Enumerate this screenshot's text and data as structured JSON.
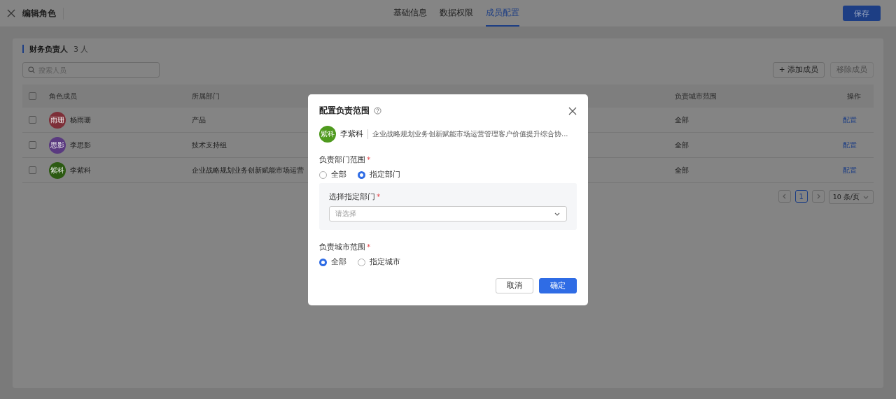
{
  "header": {
    "title": "编辑角色",
    "tabs": [
      {
        "label": "基础信息",
        "selected": false
      },
      {
        "label": "数据权限",
        "selected": false
      },
      {
        "label": "成员配置",
        "selected": true
      }
    ],
    "save": "保存"
  },
  "section": {
    "title": "财务负责人",
    "count": "3 人",
    "search": {
      "placeholder": "搜索人员"
    },
    "add": "添加成员",
    "add_icon": "+",
    "remove": {
      "label": "移除成员",
      "disabled": true
    }
  },
  "table": {
    "all_checked": false,
    "columns": [
      "角色成员",
      "所属部门",
      "负责城市范围",
      "操作"
    ],
    "rows": [
      {
        "checked": false,
        "avatar": "雨珊",
        "color": "#7d2f38",
        "name": "杨雨珊",
        "dept": "产品",
        "city": "全部",
        "action": "配置"
      },
      {
        "checked": false,
        "avatar": "思影",
        "color": "#5a3a80",
        "name": "李思影",
        "dept": "技术支持组",
        "city": "全部",
        "action": "配置"
      },
      {
        "checked": false,
        "avatar": "紫科",
        "color": "#2c5a12",
        "name": "李紫科",
        "dept": "企业战略规划业务创新赋能市场运营",
        "city": "全部",
        "action": "配置"
      }
    ]
  },
  "pagination": {
    "pages": [
      {
        "label": "1",
        "selected": true
      }
    ],
    "page_size": "10 条/页"
  },
  "modal": {
    "title": "配置负责范围",
    "member": {
      "avatar": "紫科",
      "color": "#4f9a1e",
      "name": "李紫科",
      "dept": "企业战略规划业务创新赋能市场运营管理客户价值提升综合协..."
    },
    "dept_scope": {
      "label": "负责部门范围",
      "required_mark": "*",
      "options": [
        {
          "label": "全部",
          "selected": false
        },
        {
          "label": "指定部门",
          "selected": true
        }
      ]
    },
    "dept_select": {
      "label": "选择指定部门",
      "required_mark": "*",
      "placeholder": "请选择"
    },
    "city_scope": {
      "label": "负责城市范围",
      "required_mark": "*",
      "options": [
        {
          "label": "全部",
          "selected": true
        },
        {
          "label": "指定城市",
          "selected": false
        }
      ]
    },
    "cancel": "取消",
    "ok": "确定"
  }
}
